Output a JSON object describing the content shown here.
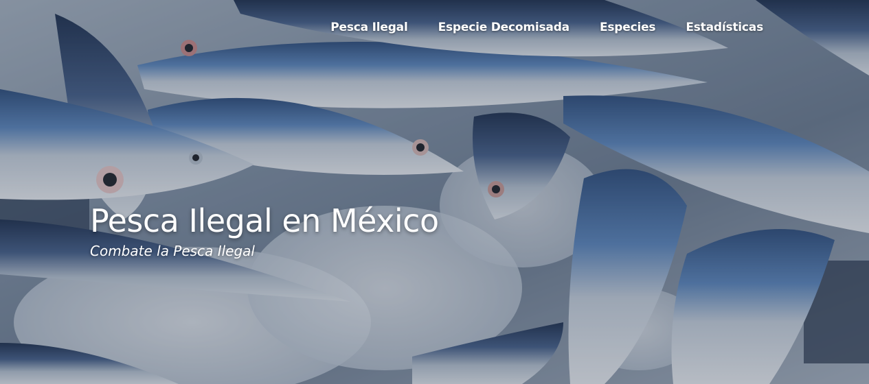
{
  "nav": {
    "items": [
      {
        "label": "Pesca Ilegal"
      },
      {
        "label": "Especie Decomisada"
      },
      {
        "label": "Especies"
      },
      {
        "label": "Estadísticas"
      }
    ]
  },
  "hero": {
    "title": "Pesca Ilegal en México",
    "subtitle": "Combate la Pesca Ilegal"
  },
  "colors": {
    "text": "#ffffff",
    "fish_back": "#4f78b0",
    "ice": "#dfe6ee"
  }
}
